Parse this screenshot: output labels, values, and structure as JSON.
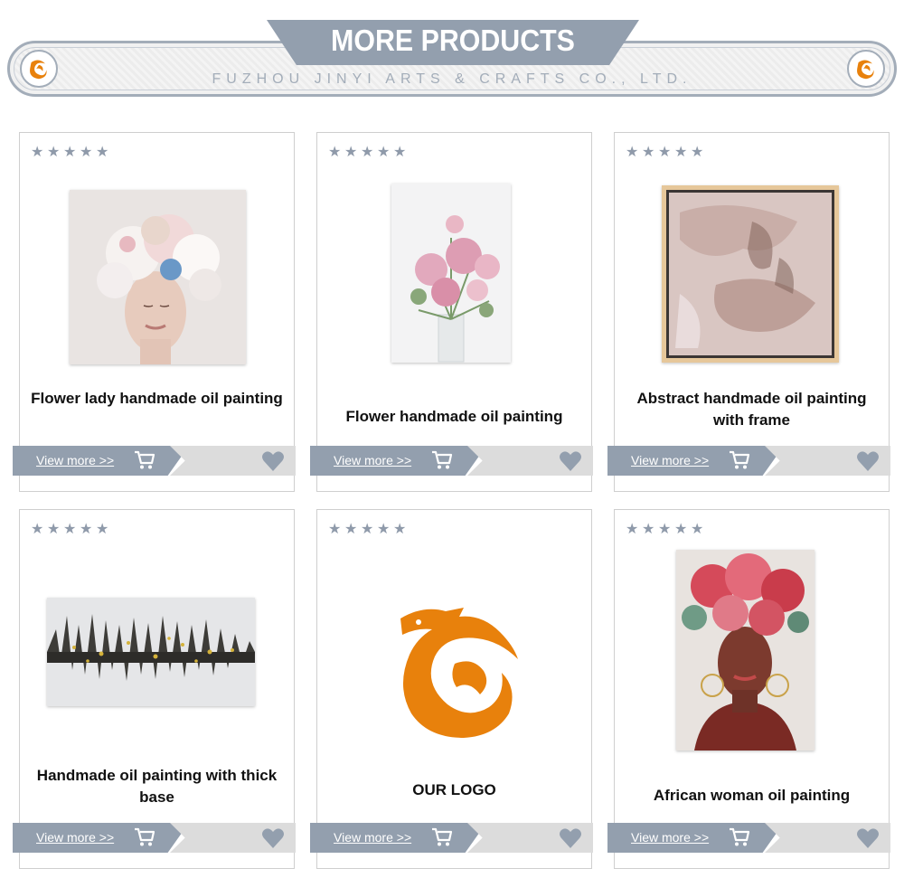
{
  "header": {
    "title": "MORE PRODUCTS",
    "subtitle": "FUZHOU JINYI ARTS & CRAFTS CO., LTD."
  },
  "icons": {
    "logo": "dragon-logo-icon",
    "rating": "star-icon",
    "cart": "shopping-cart-icon",
    "favorite": "heart-icon"
  },
  "colors": {
    "accent": "#939fae",
    "brand_orange": "#e8810c",
    "light_bar": "#dcdcdc"
  },
  "products": [
    {
      "caption": "Flower lady handmade oil painting",
      "rating": 5,
      "link": "View more >>"
    },
    {
      "caption": "Flower handmade oil painting",
      "rating": 5,
      "link": "View more >>"
    },
    {
      "caption": "Abstract handmade oil painting with frame",
      "rating": 5,
      "link": "View more >>"
    },
    {
      "caption": "Handmade oil painting with thick base",
      "rating": 5,
      "link": "View more >>"
    },
    {
      "caption": "OUR LOGO",
      "rating": 5,
      "link": "View more >>"
    },
    {
      "caption": "African woman oil painting",
      "rating": 5,
      "link": "View more >>"
    }
  ]
}
